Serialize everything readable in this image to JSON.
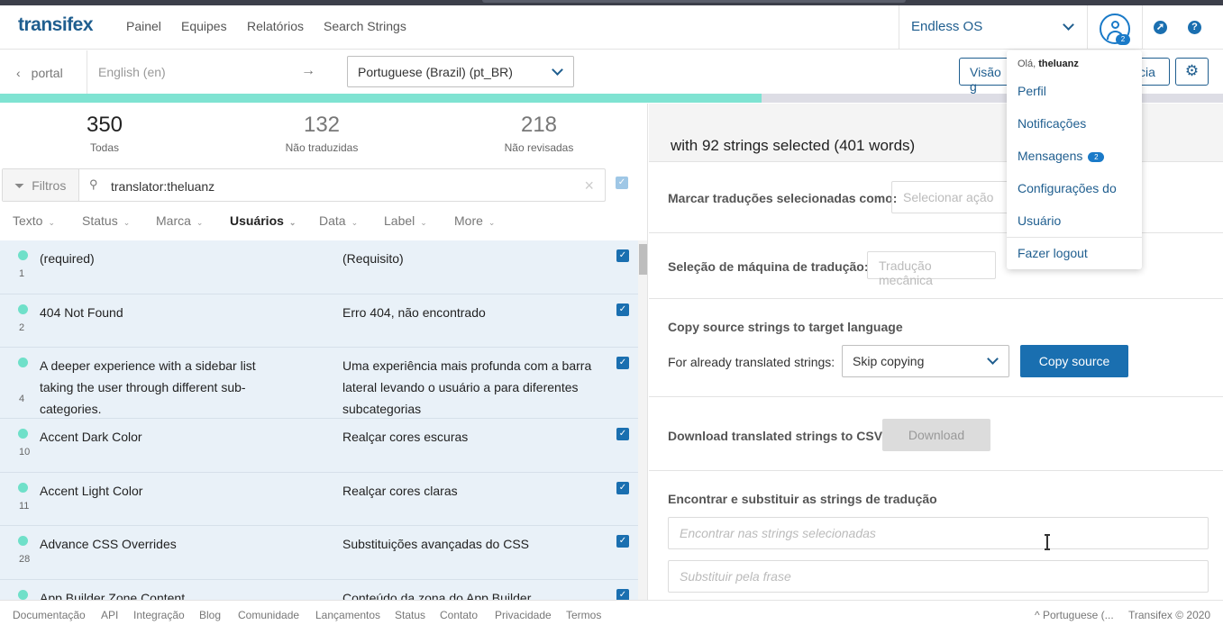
{
  "nav": {
    "logo": "transifex",
    "links": [
      "Painel",
      "Equipes",
      "Relatórios",
      "Search Strings"
    ],
    "project": "Endless OS",
    "notification_count": "2"
  },
  "subbar": {
    "back_label": "portal",
    "source_language": "English (en)",
    "arrow": "→",
    "target_language": "Portuguese (Brazil) (pt_BR)",
    "view_button_left": "Visão g",
    "view_button_right": "cia"
  },
  "progress": {
    "translated_fraction": 0.623
  },
  "stats": [
    {
      "value": "350",
      "label": "Todas"
    },
    {
      "value": "132",
      "label": "Não traduzidas"
    },
    {
      "value": "218",
      "label": "Não revisadas"
    }
  ],
  "filter": {
    "button_label": "Filtros",
    "query": "translator:theluanz"
  },
  "facets": [
    "Texto",
    "Status",
    "Marca",
    "Usuários",
    "Data",
    "Label",
    "More"
  ],
  "rows": [
    {
      "source": "(required)",
      "translation": "(Requisito)",
      "number": "1"
    },
    {
      "source": "404 Not Found",
      "translation": "Erro 404, não encontrado",
      "number": "2"
    },
    {
      "source": "A deeper experience with a sidebar list taking the user through different sub-categories.",
      "translation": "Uma experiência mais profunda com a barra lateral levando o usuário a para diferentes subcategorias",
      "number": "4"
    },
    {
      "source": "Accent Dark Color",
      "translation": "Realçar cores escuras",
      "number": "10"
    },
    {
      "source": "Accent Light Color",
      "translation": "Realçar cores claras",
      "number": "11"
    },
    {
      "source": "Advance CSS Overrides",
      "translation": "Substituições avançadas do CSS",
      "number": "28"
    },
    {
      "source": "App Builder Zone Content",
      "translation": "Conteúdo da zona do App Builder",
      "number": ""
    }
  ],
  "panel": {
    "header": "with 92 strings selected (401 words)",
    "mark_label": "Marcar traduções selecionadas como:",
    "mark_placeholder": "Selecionar ação",
    "mt_label": "Seleção de máquina de tradução:",
    "mt_placeholder": "Tradução mecânica",
    "copy_title": "Copy source strings to target language",
    "copy_label": "For already translated strings:",
    "copy_select": "Skip copying",
    "copy_button": "Copy source",
    "download_label": "Download translated strings to CSV:",
    "download_button": "Download",
    "find_title": "Encontrar e substituir as strings de tradução",
    "find_placeholder": "Encontrar nas strings selecionadas",
    "replace_placeholder": "Substituir pela frase"
  },
  "user_menu": {
    "greeting": "Olá,",
    "username": "theluanz",
    "items": [
      "Perfil",
      "Notificações",
      "Mensagens",
      "Configurações do",
      "Usuário",
      "Fazer logout"
    ],
    "messages_count": "2"
  },
  "footer": {
    "links": [
      "Documentação",
      "API",
      "Integração",
      "Blog",
      "Comunidade",
      "Lançamentos",
      "Status",
      "Contato",
      "Privacidade",
      "Termos"
    ],
    "language": "^ Portuguese (...",
    "copyright": "Transifex © 2020"
  }
}
